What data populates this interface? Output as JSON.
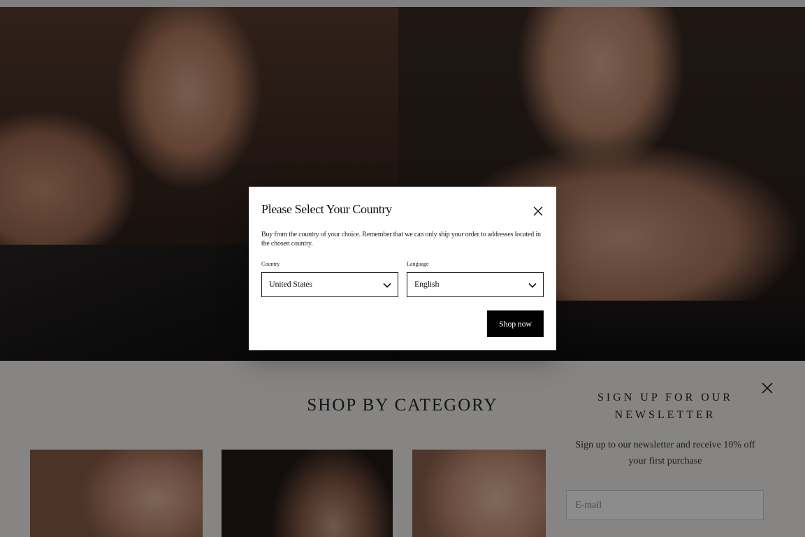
{
  "modal": {
    "title": "Please Select Your Country",
    "description": "Buy from the country of your choice. Remember that we can only ship your order to addresses located in the chosen country.",
    "country_label": "Country",
    "country_value": "United States",
    "language_label": "Language",
    "language_value": "English",
    "submit_label": "Shop now"
  },
  "section": {
    "title": "SHOP BY CATEGORY"
  },
  "newsletter": {
    "title": "SIGN UP FOR OUR NEWSLETTER",
    "text": "Sign up to our newsletter and receive 10% off your first purchase",
    "email_placeholder": "E-mail"
  },
  "icons": {
    "modal_close": "close-icon",
    "newsletter_close": "close-icon",
    "select_chevron": "chevron-down-icon"
  },
  "colors": {
    "button_bg": "#000000",
    "page_bg": "#f4f3f1"
  }
}
